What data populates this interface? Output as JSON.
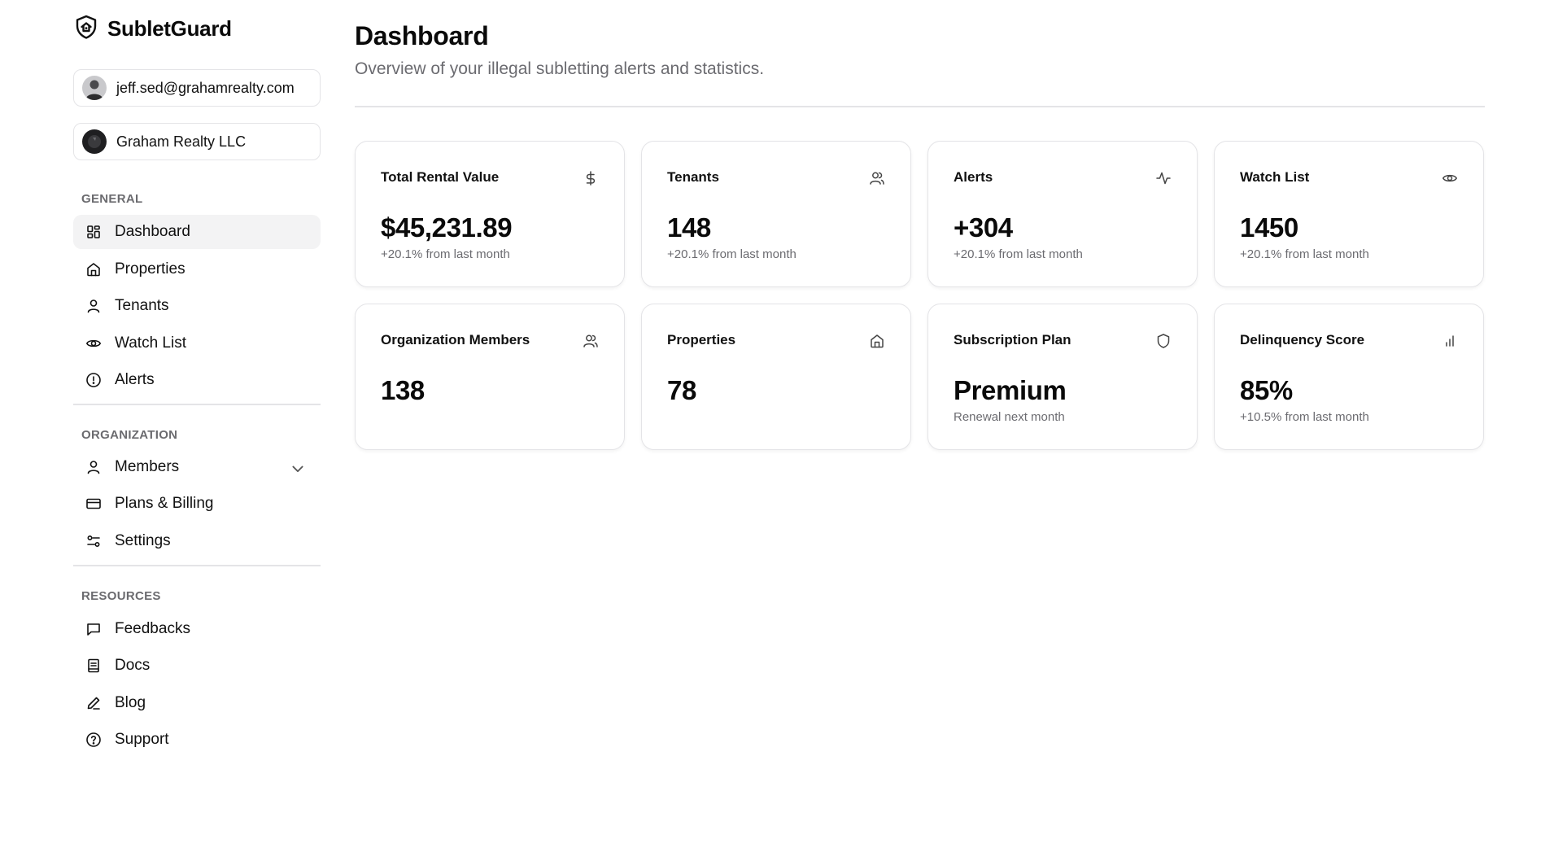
{
  "brand": {
    "name": "SubletGuard"
  },
  "account": {
    "email": "jeff.sed@grahamrealty.com",
    "organization": "Graham Realty LLC"
  },
  "sidebar": {
    "general": {
      "label": "GENERAL",
      "items": [
        {
          "label": "Dashboard",
          "icon": "dashboard-icon",
          "active": true
        },
        {
          "label": "Properties",
          "icon": "home-icon"
        },
        {
          "label": "Tenants",
          "icon": "user-icon"
        },
        {
          "label": "Watch List",
          "icon": "eye-icon"
        },
        {
          "label": "Alerts",
          "icon": "alert-circle-icon"
        }
      ]
    },
    "organization": {
      "label": "ORGANIZATION",
      "items": [
        {
          "label": "Members",
          "icon": "user-icon",
          "expandable": true
        },
        {
          "label": "Plans & Billing",
          "icon": "credit-card-icon"
        },
        {
          "label": "Settings",
          "icon": "sliders-icon"
        }
      ]
    },
    "resources": {
      "label": "RESOURCES",
      "items": [
        {
          "label": "Feedbacks",
          "icon": "message-square-icon"
        },
        {
          "label": "Docs",
          "icon": "book-icon"
        },
        {
          "label": "Blog",
          "icon": "pencil-icon"
        },
        {
          "label": "Support",
          "icon": "help-circle-icon"
        }
      ]
    }
  },
  "header": {
    "title": "Dashboard",
    "subtitle": "Overview of your illegal subletting alerts and statistics."
  },
  "cards": [
    {
      "title": "Total Rental Value",
      "value": "$45,231.89",
      "delta": "+20.1% from last month",
      "icon": "dollar-icon"
    },
    {
      "title": "Tenants",
      "value": "148",
      "delta": "+20.1% from last month",
      "icon": "users-icon"
    },
    {
      "title": "Alerts",
      "value": "+304",
      "delta": "+20.1% from last month",
      "icon": "activity-icon"
    },
    {
      "title": "Watch List",
      "value": "1450",
      "delta": "+20.1% from last month",
      "icon": "eye-icon"
    },
    {
      "title": "Organization Members",
      "value": "138",
      "delta": "",
      "icon": "users-icon"
    },
    {
      "title": "Properties",
      "value": "78",
      "delta": "",
      "icon": "home-icon"
    },
    {
      "title": "Subscription Plan",
      "value": "Premium",
      "delta": "Renewal next month",
      "icon": "shield-icon"
    },
    {
      "title": "Delinquency Score",
      "value": "85%",
      "delta": "+10.5% from last month",
      "icon": "bar-chart-icon"
    }
  ],
  "colors": {
    "text": "#0a0a0a",
    "muted": "#6b6b70",
    "border": "#e4e4e7",
    "active_bg": "#f3f3f4"
  }
}
